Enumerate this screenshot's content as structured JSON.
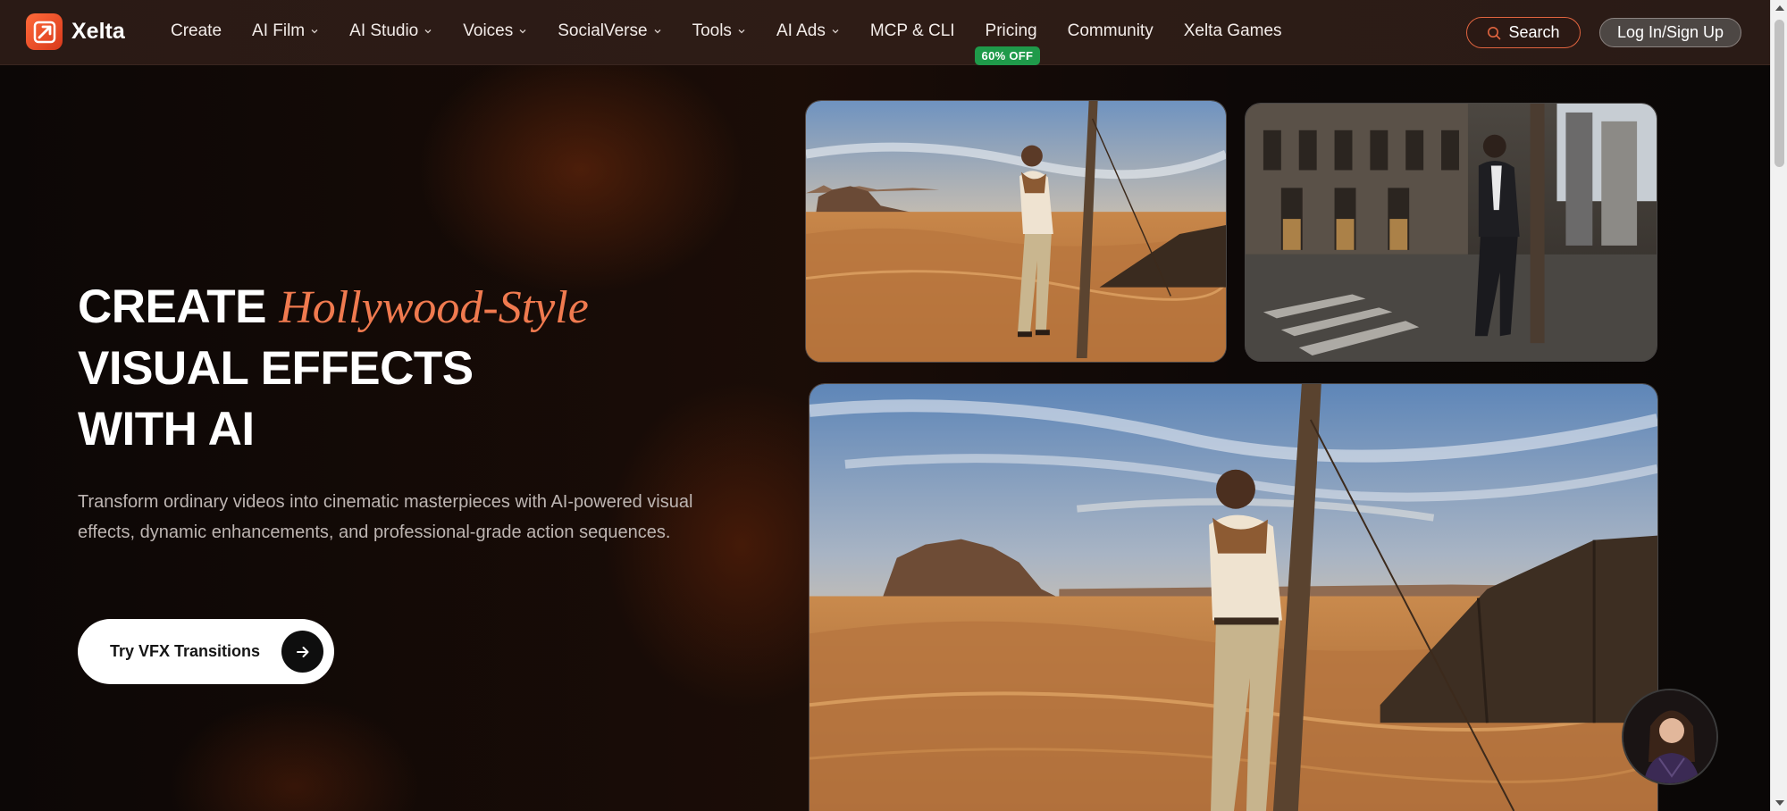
{
  "brand": {
    "name": "Xelta",
    "icon": "xelta-logo-icon",
    "accent": "#e5532a"
  },
  "nav": {
    "items": [
      {
        "label": "Create",
        "dropdown": false
      },
      {
        "label": "AI Film",
        "dropdown": true
      },
      {
        "label": "AI Studio",
        "dropdown": true
      },
      {
        "label": "Voices",
        "dropdown": true
      },
      {
        "label": "SocialVerse",
        "dropdown": true
      },
      {
        "label": "Tools",
        "dropdown": true
      },
      {
        "label": "AI Ads",
        "dropdown": true
      },
      {
        "label": "MCP & CLI",
        "dropdown": false
      },
      {
        "label": "Pricing",
        "dropdown": false,
        "badge": "60% OFF"
      },
      {
        "label": "Community",
        "dropdown": false
      },
      {
        "label": "Xelta Games",
        "dropdown": false
      }
    ],
    "search_label": "Search",
    "login_label": "Log In/Sign Up",
    "badge_color": "#1f9a4a"
  },
  "hero": {
    "title_prefix": "CREATE",
    "title_accent": "Hollywood-Style",
    "title_line2": "VISUAL EFFECTS",
    "title_line3": "WITH AI",
    "accent_color": "#f07a4f",
    "description": "Transform ordinary videos into cinematic masterpieces with AI-powered visual effects, dynamic enhancements, and professional-grade action sequences.",
    "cta_label": "Try VFX Transitions"
  }
}
